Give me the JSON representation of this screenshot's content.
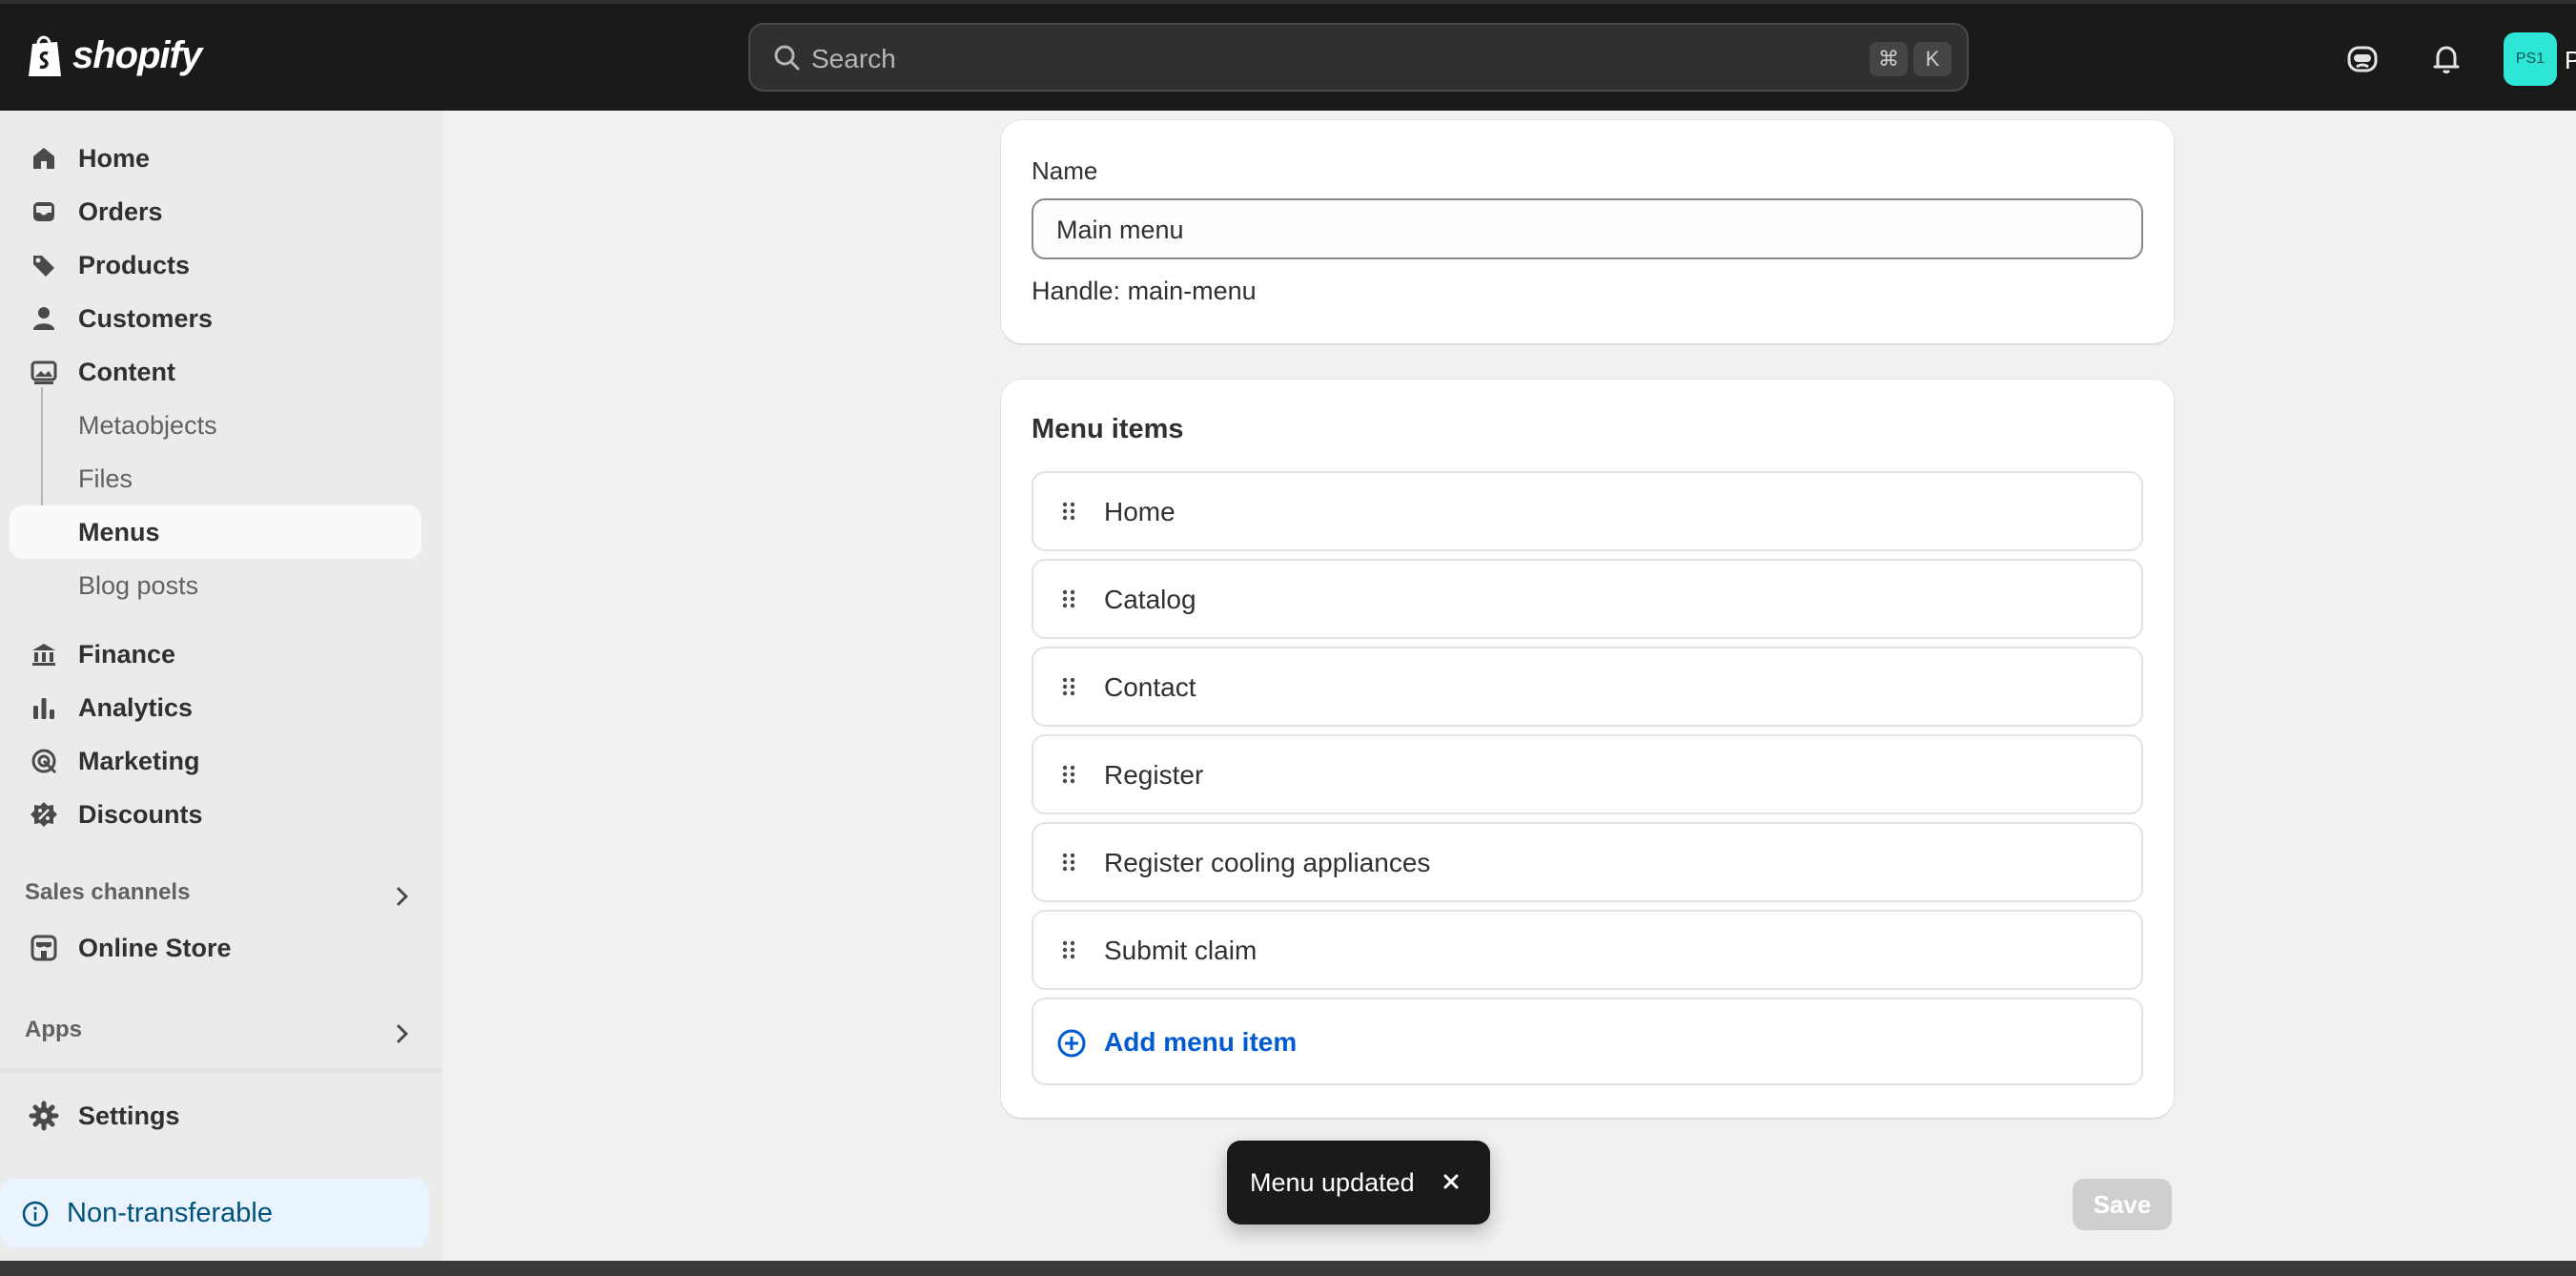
{
  "app": {
    "brand": "shopify",
    "accent": "#005bd3",
    "topbar_bg": "#1a1a1a"
  },
  "search": {
    "placeholder": "Search",
    "shortcut_cmd": "⌘",
    "shortcut_key": "K"
  },
  "user": {
    "initials": "PS1",
    "name_cut": "P",
    "avatar_color": "#2ee6d6"
  },
  "sidebar": {
    "items": [
      {
        "label": "Home",
        "icon": "home-icon"
      },
      {
        "label": "Orders",
        "icon": "inbox-icon"
      },
      {
        "label": "Products",
        "icon": "tag-icon"
      },
      {
        "label": "Customers",
        "icon": "person-icon"
      },
      {
        "label": "Content",
        "icon": "image-icon"
      },
      {
        "label": "Metaobjects"
      },
      {
        "label": "Files"
      },
      {
        "label": "Menus"
      },
      {
        "label": "Blog posts"
      },
      {
        "label": "Finance",
        "icon": "bank-icon"
      },
      {
        "label": "Analytics",
        "icon": "bar-chart-icon"
      },
      {
        "label": "Marketing",
        "icon": "target-icon"
      },
      {
        "label": "Discounts",
        "icon": "discount-icon"
      }
    ],
    "sales_channels": "Sales channels",
    "online_store": "Online Store",
    "apps": "Apps",
    "settings": "Settings",
    "non_transferable": "Non-transferable"
  },
  "menu": {
    "name_label": "Name",
    "name_value": "Main menu",
    "handle": "Handle: main-menu",
    "items_title": "Menu items",
    "items": [
      "Home",
      "Catalog",
      "Contact",
      "Register",
      "Register cooling appliances",
      "Submit claim"
    ],
    "add_label": "Add menu item"
  },
  "toast": {
    "message": "Menu updated"
  },
  "actions": {
    "save_label": "Save"
  }
}
